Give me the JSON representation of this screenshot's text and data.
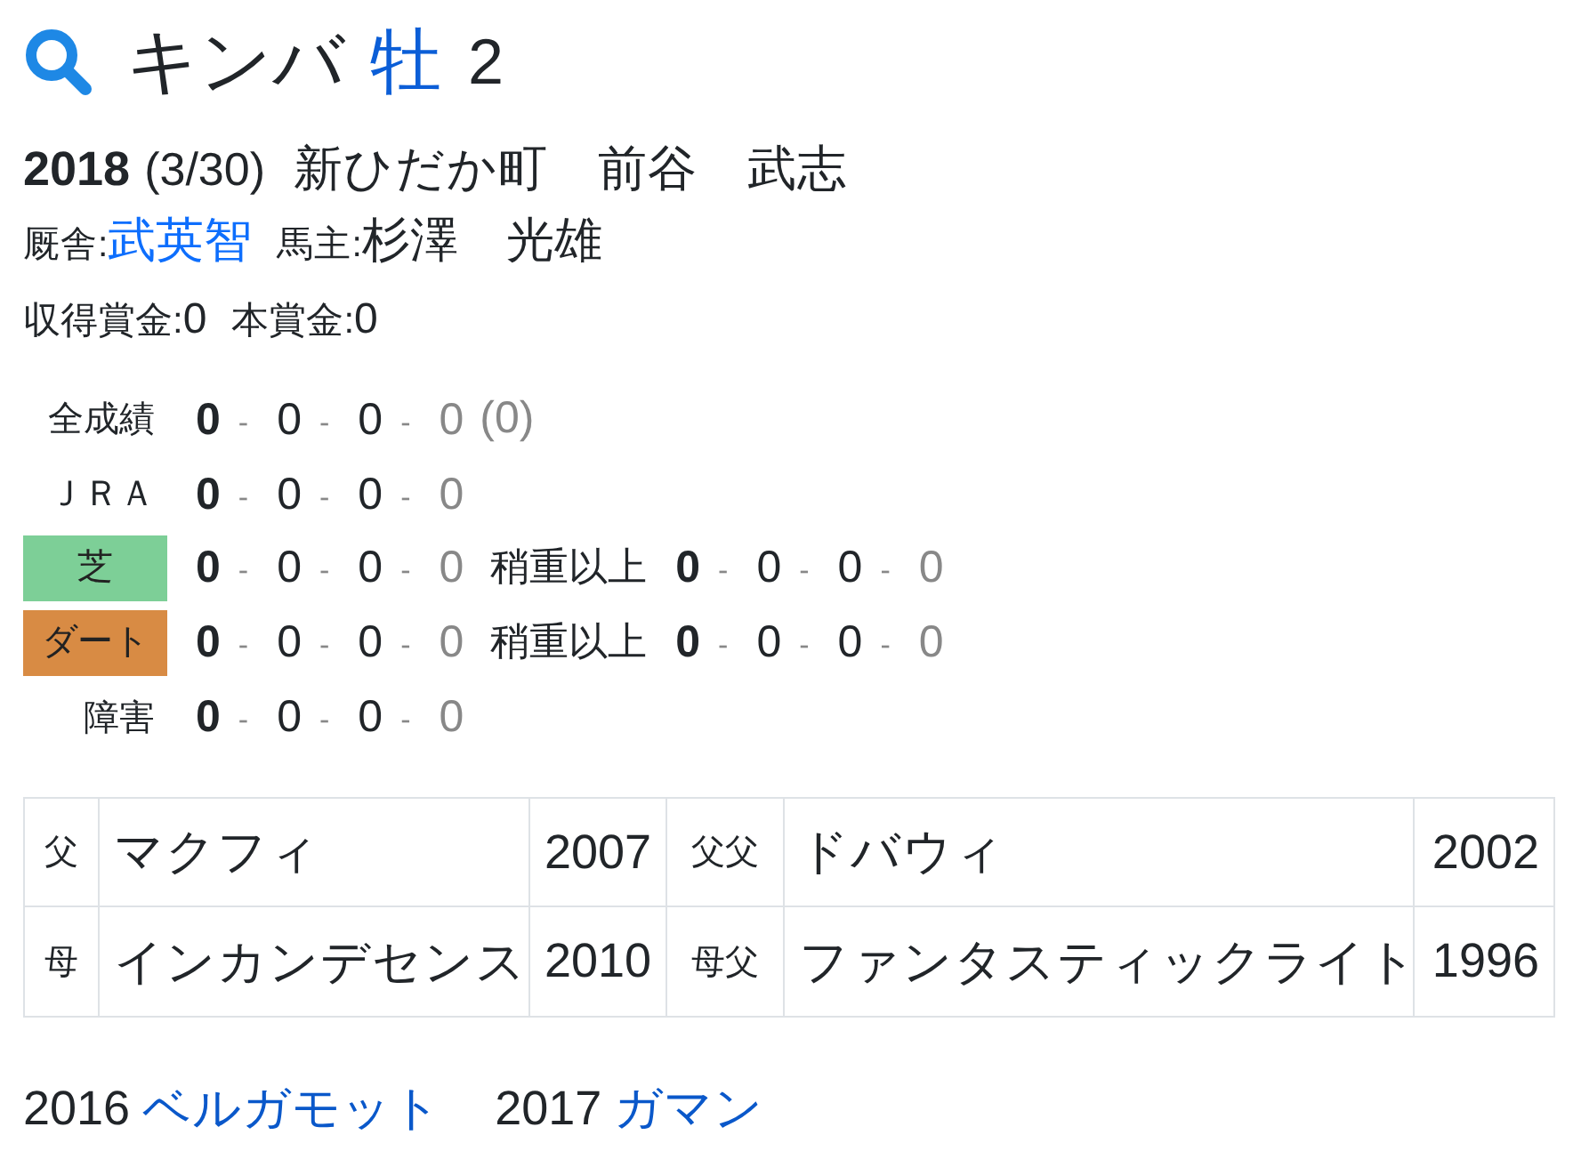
{
  "title": {
    "name": "キンバ",
    "sex": "牡",
    "age": "2"
  },
  "birth": {
    "year": "2018",
    "date": "(3/30)",
    "breeder": "新ひだか町　前谷　武志"
  },
  "connections": [
    {
      "label": "厩舎:",
      "name": "武英智",
      "kind": "link"
    },
    {
      "label": "馬主:",
      "name": "杉澤　光雄",
      "kind": "text"
    }
  ],
  "prize_money": [
    {
      "label": "収得賞金:",
      "value": "0"
    },
    {
      "label": "本賞金:",
      "value": "0"
    }
  ],
  "records": [
    {
      "label": "全成績",
      "score": [
        "0",
        "-",
        "0",
        "-",
        "0",
        "-",
        "0"
      ],
      "note": "(0)"
    },
    {
      "label": "ＪＲＡ",
      "score": [
        "0",
        "-",
        "0",
        "-",
        "0",
        "-",
        "0"
      ]
    },
    {
      "label": "芝",
      "color": "#7dcf97",
      "score": [
        "0",
        "-",
        "0",
        "-",
        "0",
        "-",
        "0"
      ],
      "condition": {
        "label": "稍重以上",
        "score": [
          "0",
          "-",
          "0",
          "-",
          "0",
          "-",
          "0"
        ]
      }
    },
    {
      "label": "ダート",
      "color": "#d88b44",
      "score": [
        "0",
        "-",
        "0",
        "-",
        "0",
        "-",
        "0"
      ],
      "condition": {
        "label": "稍重以上",
        "score": [
          "0",
          "-",
          "0",
          "-",
          "0",
          "-",
          "0"
        ]
      }
    },
    {
      "label": "障害",
      "score": [
        "0",
        "-",
        "0",
        "-",
        "0",
        "-",
        "0"
      ]
    }
  ],
  "pedigree": [
    {
      "left": {
        "relation": "父",
        "name": "マクフィ",
        "year": "2007"
      },
      "right": {
        "relation": "父父",
        "name": "ドバウィ",
        "year": "2002"
      }
    },
    {
      "left": {
        "relation": "母",
        "name": "インカンデセンス",
        "year": "2010"
      },
      "right": {
        "relation": "母父",
        "name": "ファンタスティックライト",
        "year": "1996"
      }
    }
  ],
  "siblings": [
    {
      "year": "2016",
      "name": "ベルガモット"
    },
    {
      "year": "2017",
      "name": "ガマン"
    }
  ]
}
